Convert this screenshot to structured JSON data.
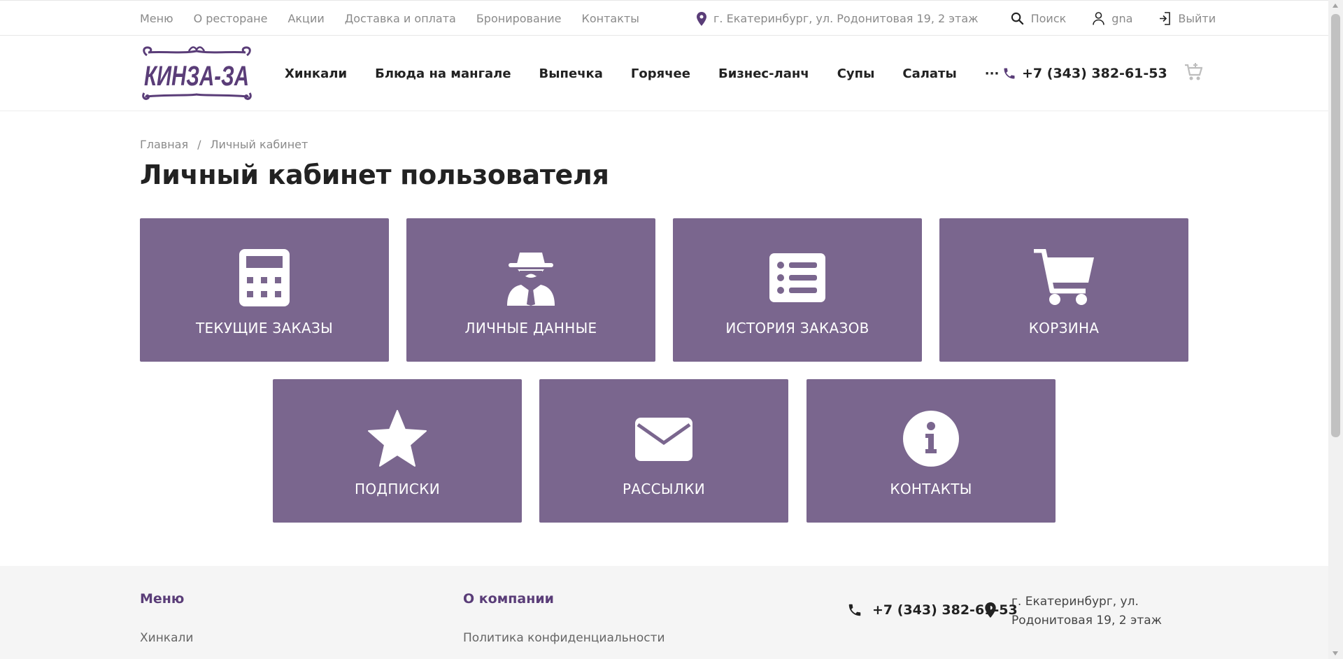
{
  "topbar": {
    "nav": [
      "Меню",
      "О ресторане",
      "Акции",
      "Доставка и оплата",
      "Бронирование",
      "Контакты"
    ],
    "address": "г. Екатеринбург, ул. Родонитовая 19, 2 этаж",
    "search_label": "Поиск",
    "user_name": "gna",
    "logout_label": "Выйти"
  },
  "header": {
    "logo_text": "КИНЗА-ЗА",
    "nav": [
      "Хинкали",
      "Блюда на мангале",
      "Выпечка",
      "Горячее",
      "Бизнес-ланч",
      "Супы",
      "Салаты",
      "···"
    ],
    "phone": "+7 (343) 382-61-53"
  },
  "breadcrumb": {
    "home": "Главная",
    "separator": "/",
    "current": "Личный кабинет"
  },
  "page_title": "Личный кабинет пользователя",
  "tiles": [
    {
      "label": "ТЕКУЩИЕ ЗАКАЗЫ",
      "icon": "calculator-icon"
    },
    {
      "label": "ЛИЧНЫЕ ДАННЫЕ",
      "icon": "user-secret-icon"
    },
    {
      "label": "ИСТОРИЯ ЗАКАЗОВ",
      "icon": "list-icon"
    },
    {
      "label": "КОРЗИНА",
      "icon": "shopping-cart-icon"
    },
    {
      "label": "ПОДПИСКИ",
      "icon": "star-icon"
    },
    {
      "label": "РАССЫЛКИ",
      "icon": "envelope-icon"
    },
    {
      "label": "КОНТАКТЫ",
      "icon": "info-circle-icon"
    }
  ],
  "footer": {
    "menu_heading": "Меню",
    "menu_link": "Хинкали",
    "company_heading": "О компании",
    "company_link": "Политика конфиденциальности",
    "phone": "+7 (343) 382-61-53",
    "address_line1": "г. Екатеринбург, ул.",
    "address_line2": "Родонитовая 19, 2 этаж"
  },
  "colors": {
    "tile_bg": "#7a668e",
    "brand_purple": "#5a3d78",
    "muted_text": "#8a8a8a"
  }
}
